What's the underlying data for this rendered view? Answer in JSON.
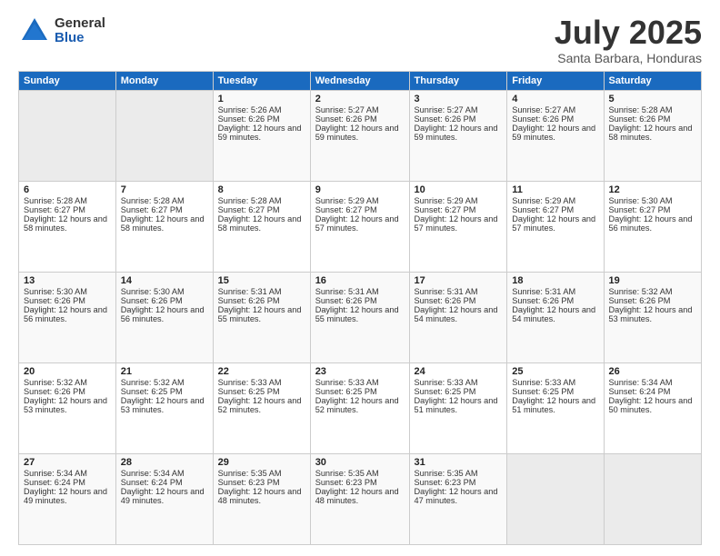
{
  "logo": {
    "general": "General",
    "blue": "Blue"
  },
  "title": "July 2025",
  "location": "Santa Barbara, Honduras",
  "days_header": [
    "Sunday",
    "Monday",
    "Tuesday",
    "Wednesday",
    "Thursday",
    "Friday",
    "Saturday"
  ],
  "weeks": [
    [
      {
        "day": "",
        "sunrise": "",
        "sunset": "",
        "daylight": "",
        "empty": true
      },
      {
        "day": "",
        "sunrise": "",
        "sunset": "",
        "daylight": "",
        "empty": true
      },
      {
        "day": "1",
        "sunrise": "Sunrise: 5:26 AM",
        "sunset": "Sunset: 6:26 PM",
        "daylight": "Daylight: 12 hours and 59 minutes."
      },
      {
        "day": "2",
        "sunrise": "Sunrise: 5:27 AM",
        "sunset": "Sunset: 6:26 PM",
        "daylight": "Daylight: 12 hours and 59 minutes."
      },
      {
        "day": "3",
        "sunrise": "Sunrise: 5:27 AM",
        "sunset": "Sunset: 6:26 PM",
        "daylight": "Daylight: 12 hours and 59 minutes."
      },
      {
        "day": "4",
        "sunrise": "Sunrise: 5:27 AM",
        "sunset": "Sunset: 6:26 PM",
        "daylight": "Daylight: 12 hours and 59 minutes."
      },
      {
        "day": "5",
        "sunrise": "Sunrise: 5:28 AM",
        "sunset": "Sunset: 6:26 PM",
        "daylight": "Daylight: 12 hours and 58 minutes."
      }
    ],
    [
      {
        "day": "6",
        "sunrise": "Sunrise: 5:28 AM",
        "sunset": "Sunset: 6:27 PM",
        "daylight": "Daylight: 12 hours and 58 minutes."
      },
      {
        "day": "7",
        "sunrise": "Sunrise: 5:28 AM",
        "sunset": "Sunset: 6:27 PM",
        "daylight": "Daylight: 12 hours and 58 minutes."
      },
      {
        "day": "8",
        "sunrise": "Sunrise: 5:28 AM",
        "sunset": "Sunset: 6:27 PM",
        "daylight": "Daylight: 12 hours and 58 minutes."
      },
      {
        "day": "9",
        "sunrise": "Sunrise: 5:29 AM",
        "sunset": "Sunset: 6:27 PM",
        "daylight": "Daylight: 12 hours and 57 minutes."
      },
      {
        "day": "10",
        "sunrise": "Sunrise: 5:29 AM",
        "sunset": "Sunset: 6:27 PM",
        "daylight": "Daylight: 12 hours and 57 minutes."
      },
      {
        "day": "11",
        "sunrise": "Sunrise: 5:29 AM",
        "sunset": "Sunset: 6:27 PM",
        "daylight": "Daylight: 12 hours and 57 minutes."
      },
      {
        "day": "12",
        "sunrise": "Sunrise: 5:30 AM",
        "sunset": "Sunset: 6:27 PM",
        "daylight": "Daylight: 12 hours and 56 minutes."
      }
    ],
    [
      {
        "day": "13",
        "sunrise": "Sunrise: 5:30 AM",
        "sunset": "Sunset: 6:26 PM",
        "daylight": "Daylight: 12 hours and 56 minutes."
      },
      {
        "day": "14",
        "sunrise": "Sunrise: 5:30 AM",
        "sunset": "Sunset: 6:26 PM",
        "daylight": "Daylight: 12 hours and 56 minutes."
      },
      {
        "day": "15",
        "sunrise": "Sunrise: 5:31 AM",
        "sunset": "Sunset: 6:26 PM",
        "daylight": "Daylight: 12 hours and 55 minutes."
      },
      {
        "day": "16",
        "sunrise": "Sunrise: 5:31 AM",
        "sunset": "Sunset: 6:26 PM",
        "daylight": "Daylight: 12 hours and 55 minutes."
      },
      {
        "day": "17",
        "sunrise": "Sunrise: 5:31 AM",
        "sunset": "Sunset: 6:26 PM",
        "daylight": "Daylight: 12 hours and 54 minutes."
      },
      {
        "day": "18",
        "sunrise": "Sunrise: 5:31 AM",
        "sunset": "Sunset: 6:26 PM",
        "daylight": "Daylight: 12 hours and 54 minutes."
      },
      {
        "day": "19",
        "sunrise": "Sunrise: 5:32 AM",
        "sunset": "Sunset: 6:26 PM",
        "daylight": "Daylight: 12 hours and 53 minutes."
      }
    ],
    [
      {
        "day": "20",
        "sunrise": "Sunrise: 5:32 AM",
        "sunset": "Sunset: 6:26 PM",
        "daylight": "Daylight: 12 hours and 53 minutes."
      },
      {
        "day": "21",
        "sunrise": "Sunrise: 5:32 AM",
        "sunset": "Sunset: 6:25 PM",
        "daylight": "Daylight: 12 hours and 53 minutes."
      },
      {
        "day": "22",
        "sunrise": "Sunrise: 5:33 AM",
        "sunset": "Sunset: 6:25 PM",
        "daylight": "Daylight: 12 hours and 52 minutes."
      },
      {
        "day": "23",
        "sunrise": "Sunrise: 5:33 AM",
        "sunset": "Sunset: 6:25 PM",
        "daylight": "Daylight: 12 hours and 52 minutes."
      },
      {
        "day": "24",
        "sunrise": "Sunrise: 5:33 AM",
        "sunset": "Sunset: 6:25 PM",
        "daylight": "Daylight: 12 hours and 51 minutes."
      },
      {
        "day": "25",
        "sunrise": "Sunrise: 5:33 AM",
        "sunset": "Sunset: 6:25 PM",
        "daylight": "Daylight: 12 hours and 51 minutes."
      },
      {
        "day": "26",
        "sunrise": "Sunrise: 5:34 AM",
        "sunset": "Sunset: 6:24 PM",
        "daylight": "Daylight: 12 hours and 50 minutes."
      }
    ],
    [
      {
        "day": "27",
        "sunrise": "Sunrise: 5:34 AM",
        "sunset": "Sunset: 6:24 PM",
        "daylight": "Daylight: 12 hours and 49 minutes."
      },
      {
        "day": "28",
        "sunrise": "Sunrise: 5:34 AM",
        "sunset": "Sunset: 6:24 PM",
        "daylight": "Daylight: 12 hours and 49 minutes."
      },
      {
        "day": "29",
        "sunrise": "Sunrise: 5:35 AM",
        "sunset": "Sunset: 6:23 PM",
        "daylight": "Daylight: 12 hours and 48 minutes."
      },
      {
        "day": "30",
        "sunrise": "Sunrise: 5:35 AM",
        "sunset": "Sunset: 6:23 PM",
        "daylight": "Daylight: 12 hours and 48 minutes."
      },
      {
        "day": "31",
        "sunrise": "Sunrise: 5:35 AM",
        "sunset": "Sunset: 6:23 PM",
        "daylight": "Daylight: 12 hours and 47 minutes."
      },
      {
        "day": "",
        "sunrise": "",
        "sunset": "",
        "daylight": "",
        "empty": true
      },
      {
        "day": "",
        "sunrise": "",
        "sunset": "",
        "daylight": "",
        "empty": true
      }
    ]
  ]
}
